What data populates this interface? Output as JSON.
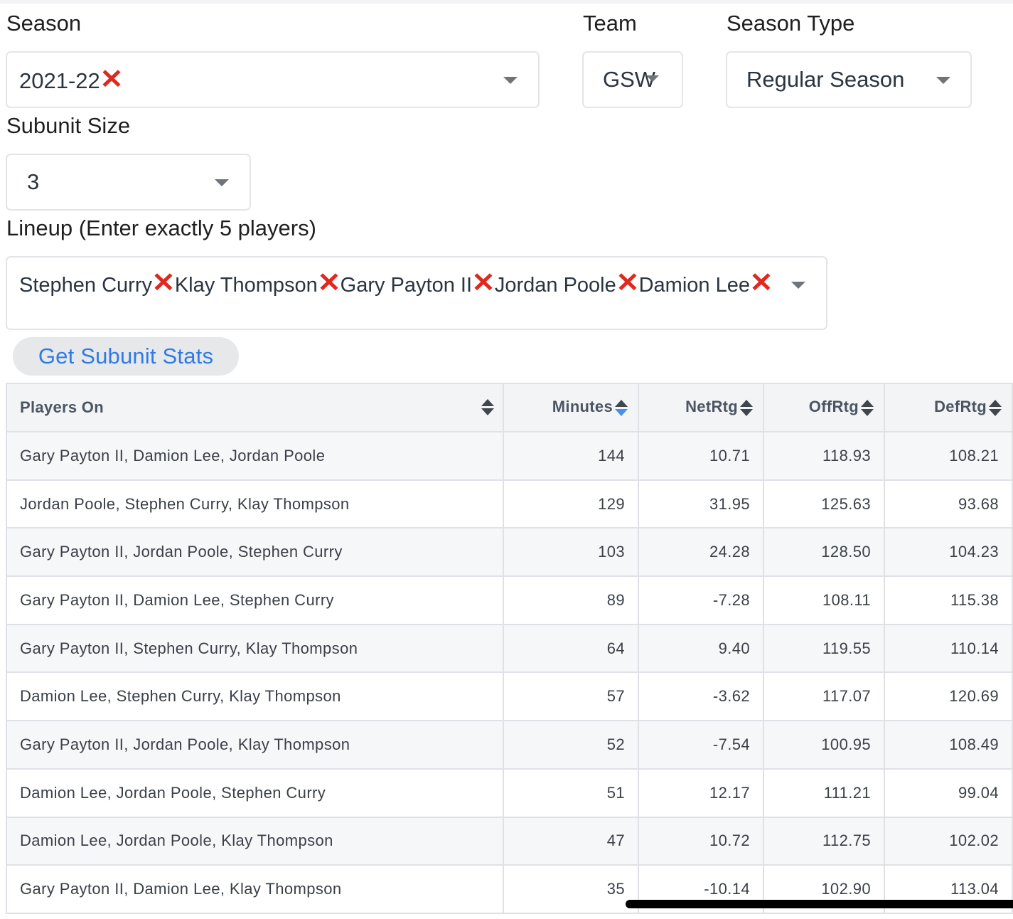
{
  "filters": {
    "season_label": "Season",
    "season_value": "2021-22",
    "team_label": "Team",
    "team_value": "GSW",
    "season_type_label": "Season Type",
    "season_type_value": "Regular Season",
    "subunit_label": "Subunit Size",
    "subunit_value": "3",
    "lineup_label": "Lineup (Enter exactly 5 players)",
    "lineup_players": [
      "Stephen Curry",
      "Klay Thompson",
      "Gary Payton II",
      "Jordan Poole",
      "Damion Lee"
    ],
    "remove_icon": "red-x-icon",
    "remove_color": "#e0281f"
  },
  "button": {
    "label": "Get Subunit Stats",
    "color": "#2f7be6"
  },
  "table": {
    "headers": [
      "Players On",
      "Minutes",
      "NetRtg",
      "OffRtg",
      "DefRtg"
    ],
    "sorted_column": "Minutes",
    "sort_direction": "descending",
    "rows": [
      [
        "Gary Payton II, Damion Lee, Jordan Poole",
        "144",
        "10.71",
        "118.93",
        "108.21"
      ],
      [
        "Jordan Poole, Stephen Curry, Klay Thompson",
        "129",
        "31.95",
        "125.63",
        "93.68"
      ],
      [
        "Gary Payton II, Jordan Poole, Stephen Curry",
        "103",
        "24.28",
        "128.50",
        "104.23"
      ],
      [
        "Gary Payton II, Damion Lee, Stephen Curry",
        "89",
        "-7.28",
        "108.11",
        "115.38"
      ],
      [
        "Gary Payton II, Stephen Curry, Klay Thompson",
        "64",
        "9.40",
        "119.55",
        "110.14"
      ],
      [
        "Damion Lee, Stephen Curry, Klay Thompson",
        "57",
        "-3.62",
        "117.07",
        "120.69"
      ],
      [
        "Gary Payton II, Jordan Poole, Klay Thompson",
        "52",
        "-7.54",
        "100.95",
        "108.49"
      ],
      [
        "Damion Lee, Jordan Poole, Stephen Curry",
        "51",
        "12.17",
        "111.21",
        "99.04"
      ],
      [
        "Damion Lee, Jordan Poole, Klay Thompson",
        "47",
        "10.72",
        "112.75",
        "102.02"
      ],
      [
        "Gary Payton II, Damion Lee, Klay Thompson",
        "35",
        "-10.14",
        "102.90",
        "113.04"
      ]
    ]
  }
}
